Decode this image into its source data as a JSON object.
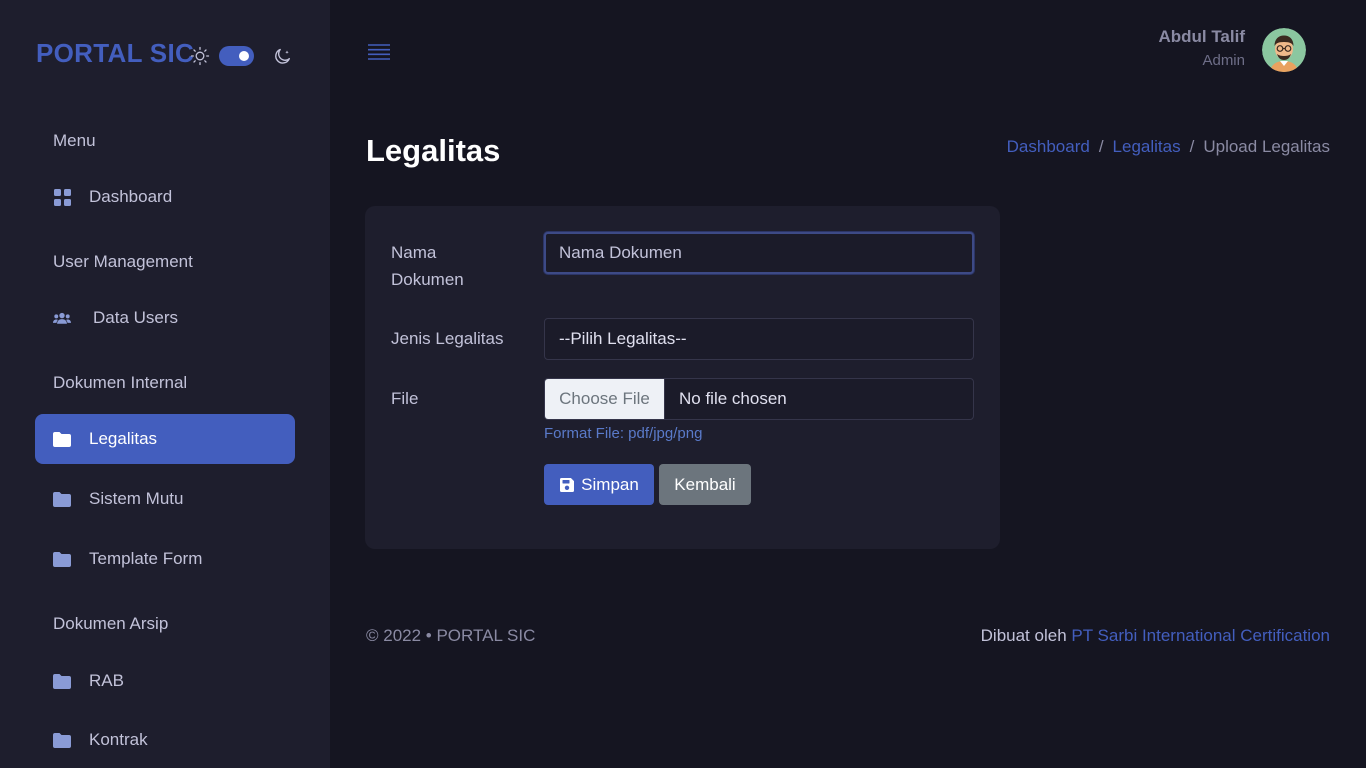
{
  "brand": {
    "title": "PORTAL SIC"
  },
  "sidebar": {
    "sections": [
      {
        "title": "Menu"
      },
      {
        "title": "User Management"
      },
      {
        "title": "Dokumen Internal"
      },
      {
        "title": "Dokumen Arsip"
      }
    ],
    "items": [
      {
        "label": "Dashboard",
        "icon": "grid-icon",
        "active": false
      },
      {
        "label": "Data Users",
        "icon": "users-icon",
        "active": false
      },
      {
        "label": "Legalitas",
        "icon": "folder-icon",
        "active": true
      },
      {
        "label": "Sistem Mutu",
        "icon": "folder-icon",
        "active": false
      },
      {
        "label": "Template Form",
        "icon": "folder-icon",
        "active": false
      },
      {
        "label": "RAB",
        "icon": "folder-icon",
        "active": false
      },
      {
        "label": "Kontrak",
        "icon": "folder-icon",
        "active": false
      }
    ]
  },
  "header": {
    "user_name": "Abdul Talif",
    "user_role": "Admin"
  },
  "page": {
    "title": "Legalitas",
    "breadcrumb": {
      "items": [
        "Dashboard",
        "Legalitas"
      ],
      "separator": "/",
      "current": "Upload Legalitas"
    }
  },
  "form": {
    "nama_label_line1": "Nama",
    "nama_label_line2": "Dokumen",
    "nama_placeholder": "Nama Dokumen",
    "jenis_label": "Jenis Legalitas",
    "jenis_selected": "--Pilih Legalitas--",
    "file_label": "File",
    "file_button": "Choose File",
    "file_status": "No file chosen",
    "file_help": "Format File: pdf/jpg/png",
    "save_label": "Simpan",
    "back_label": "Kembali"
  },
  "footer": {
    "copyright": "© 2022 • PORTAL SIC",
    "made_by_prefix": "Dibuat oleh",
    "made_by_link": "PT Sarbi International Certification"
  },
  "colors": {
    "accent": "#435ebe",
    "background": "#151521",
    "sidebar": "#1e1e2d",
    "secondary_button": "#6c757d"
  }
}
